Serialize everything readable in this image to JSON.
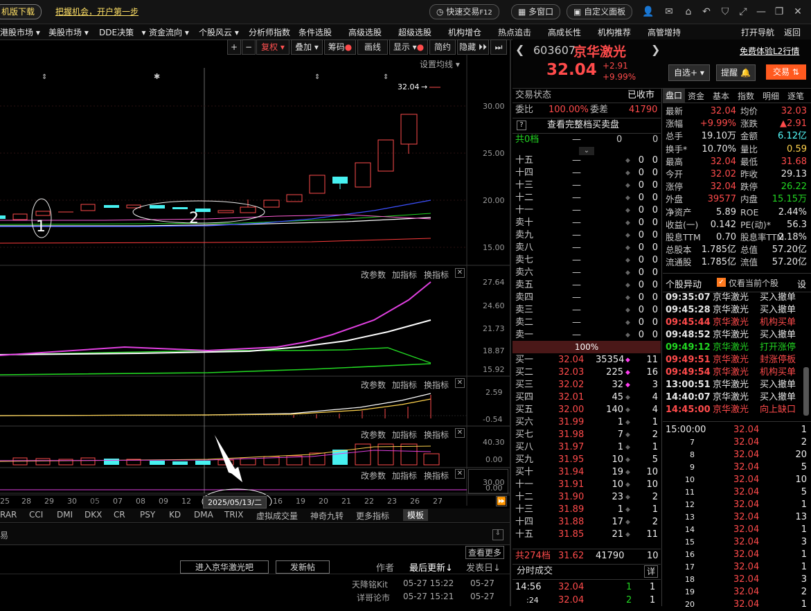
{
  "topbar": {
    "download": "机版下载",
    "promo": "把握机会，开户第一步",
    "quick_trade": "快速交易",
    "quick_trade_key": "F12",
    "multi_window": "多窗口",
    "custom_panel": "自定义面板"
  },
  "menu": [
    "港股市场",
    "美股市场",
    "DDE决策",
    "资金流向",
    "个股风云",
    "分析师指数",
    "条件选股",
    "高级选股",
    "超级选股",
    "机构增仓",
    "热点追击",
    "高成长性",
    "机构推荐",
    "高管增持"
  ],
  "menu_right": [
    "打开导航",
    "返回"
  ],
  "chart_toolbar": {
    "fuquan": "复权",
    "diejia": "叠加",
    "chouma": "筹码",
    "huaxian": "画线",
    "xianshi": "显示",
    "jianyue": "简约",
    "yincang": "隐藏",
    "set_ma": "设置均线"
  },
  "price_chart": {
    "last_label": "32.04",
    "y_ticks": [
      "30.00",
      "25.00",
      "20.00",
      "15.00"
    ],
    "annotations": [
      "1",
      "2"
    ]
  },
  "indicator_panels": [
    {
      "tools": [
        "改参数",
        "加指标",
        "换指标"
      ],
      "y_ticks": [
        "27.64",
        "24.60",
        "21.73",
        "18.87",
        "15.92"
      ]
    },
    {
      "tools": [
        "改参数",
        "加指标",
        "换指标"
      ],
      "y_ticks": [
        "2.59",
        "-0.54"
      ]
    },
    {
      "tools": [
        "改参数",
        "加指标",
        "换指标"
      ],
      "y_ticks": [
        "40.30",
        "0.00"
      ]
    },
    {
      "tools": [
        "改参数",
        "加指标",
        "换指标"
      ],
      "y_ticks": [
        "30.00",
        "0.00"
      ]
    }
  ],
  "x_dates": [
    "25",
    "28",
    "29",
    "30",
    "05",
    "07",
    "08",
    "09",
    "12",
    "2025/05/13/二",
    "16",
    "19",
    "20",
    "21",
    "22",
    "23",
    "26",
    "27"
  ],
  "indicator_tabs": [
    "RAR",
    "CCI",
    "DMI",
    "DKX",
    "CR",
    "PSY",
    "KD",
    "DMA",
    "TRIX",
    "虚拟成交量",
    "神奇九转",
    "更多指标",
    "模板"
  ],
  "forum": {
    "view_more": "查看更多",
    "enter": "进入京华激光吧",
    "post": "发新帖",
    "col_author": "作者",
    "col_updated": "最后更新↓",
    "col_posted": "发表日↓",
    "rows": [
      {
        "author": "天降铭Kit",
        "updated": "05-27 15:22",
        "posted": "05-27"
      },
      {
        "author": "详哥论市",
        "updated": "05-27 15:21",
        "posted": "05-27"
      }
    ]
  },
  "stock": {
    "code": "603607",
    "name": "京华激光",
    "price": "32.04",
    "change": "+2.91",
    "change_pct": "+9.99%",
    "l2_link": "免费体验L2行情",
    "btn_watch": "自选+",
    "btn_alert": "提醒",
    "btn_trade": "交易"
  },
  "order_book": {
    "status_label": "交易状态",
    "status_value": "已收市",
    "weibi_label": "委比",
    "weibi_value": "100.00%",
    "weicha_label": "委差",
    "weicha_value": "41790",
    "full_book": "查看完整档买卖盘",
    "sell_total": {
      "label": "共0档",
      "price": "—",
      "vol": "0",
      "cnt": "0"
    },
    "sells": [
      {
        "label": "十五",
        "price": "—",
        "vol": "0",
        "cnt": "0"
      },
      {
        "label": "十四",
        "price": "—",
        "vol": "0",
        "cnt": "0"
      },
      {
        "label": "十三",
        "price": "—",
        "vol": "0",
        "cnt": "0"
      },
      {
        "label": "十二",
        "price": "—",
        "vol": "0",
        "cnt": "0"
      },
      {
        "label": "十一",
        "price": "—",
        "vol": "0",
        "cnt": "0"
      },
      {
        "label": "卖十",
        "price": "—",
        "vol": "0",
        "cnt": "0"
      },
      {
        "label": "卖九",
        "price": "—",
        "vol": "0",
        "cnt": "0"
      },
      {
        "label": "卖八",
        "price": "—",
        "vol": "0",
        "cnt": "0"
      },
      {
        "label": "卖七",
        "price": "—",
        "vol": "0",
        "cnt": "0"
      },
      {
        "label": "卖六",
        "price": "—",
        "vol": "0",
        "cnt": "0"
      },
      {
        "label": "卖五",
        "price": "—",
        "vol": "0",
        "cnt": "0"
      },
      {
        "label": "卖四",
        "price": "—",
        "vol": "0",
        "cnt": "0"
      },
      {
        "label": "卖三",
        "price": "—",
        "vol": "0",
        "cnt": "0"
      },
      {
        "label": "卖二",
        "price": "—",
        "vol": "0",
        "cnt": "0"
      },
      {
        "label": "卖一",
        "price": "—",
        "vol": "0",
        "cnt": "0"
      }
    ],
    "ratio_bar": "100%",
    "buys": [
      {
        "label": "买一",
        "price": "32.04",
        "vol": "35354",
        "cnt": "11"
      },
      {
        "label": "买二",
        "price": "32.03",
        "vol": "225",
        "cnt": "16"
      },
      {
        "label": "买三",
        "price": "32.02",
        "vol": "32",
        "cnt": "3"
      },
      {
        "label": "买四",
        "price": "32.01",
        "vol": "45",
        "cnt": "4"
      },
      {
        "label": "买五",
        "price": "32.00",
        "vol": "140",
        "cnt": "4"
      },
      {
        "label": "买六",
        "price": "31.99",
        "vol": "1",
        "cnt": "1"
      },
      {
        "label": "买七",
        "price": "31.98",
        "vol": "7",
        "cnt": "2"
      },
      {
        "label": "买八",
        "price": "31.97",
        "vol": "1",
        "cnt": "1"
      },
      {
        "label": "买九",
        "price": "31.95",
        "vol": "10",
        "cnt": "5"
      },
      {
        "label": "买十",
        "price": "31.94",
        "vol": "19",
        "cnt": "10"
      },
      {
        "label": "十一",
        "price": "31.91",
        "vol": "10",
        "cnt": "10"
      },
      {
        "label": "十二",
        "price": "31.90",
        "vol": "23",
        "cnt": "2"
      },
      {
        "label": "十三",
        "price": "31.89",
        "vol": "1",
        "cnt": "1"
      },
      {
        "label": "十四",
        "price": "31.88",
        "vol": "17",
        "cnt": "2"
      },
      {
        "label": "十五",
        "price": "31.85",
        "vol": "21",
        "cnt": "11"
      }
    ],
    "buy_total": {
      "label": "共274档",
      "price": "31.62",
      "vol": "41790",
      "cnt": "10"
    }
  },
  "ticks_panel": {
    "title": "分时成交",
    "btn": "详",
    "rows": [
      {
        "time": "14:56",
        "price": "32.04",
        "vol": "1",
        "cnt": "1"
      },
      {
        "time": ":24",
        "price": "32.04",
        "vol": "2",
        "cnt": "1"
      }
    ]
  },
  "quote_tabs": [
    "盘口",
    "资金",
    "基本",
    "指数",
    "明细",
    "逐笔"
  ],
  "quote": [
    {
      "l": "最新",
      "v": "32.04",
      "vc": "red",
      "l2": "均价",
      "v2": "32.03",
      "v2c": "red"
    },
    {
      "l": "涨幅",
      "v": "+9.99%",
      "vc": "red",
      "l2": "涨跌",
      "v2": "▲2.91",
      "v2c": "red"
    },
    {
      "l": "总手",
      "v": "19.10万",
      "vc": "white",
      "l2": "金额",
      "v2": "6.12亿",
      "v2c": "cyan"
    },
    {
      "l": "换手*",
      "v": "10.70%",
      "vc": "white",
      "l2": "量比",
      "v2": "0.59",
      "v2c": "yellow"
    },
    {
      "l": "最高",
      "v": "32.04",
      "vc": "red",
      "l2": "最低",
      "v2": "31.68",
      "v2c": "red"
    },
    {
      "l": "今开",
      "v": "32.02",
      "vc": "red",
      "l2": "昨收",
      "v2": "29.13",
      "v2c": "white"
    },
    {
      "l": "涨停",
      "v": "32.04",
      "vc": "red",
      "l2": "跌停",
      "v2": "26.22",
      "v2c": "green"
    },
    {
      "l": "外盘",
      "v": "39577",
      "vc": "red",
      "l2": "内盘",
      "v2": "15.15万",
      "v2c": "green"
    },
    {
      "l": "净资产",
      "v": "5.89",
      "vc": "white",
      "l2": "ROE",
      "v2": "2.44%",
      "v2c": "white"
    },
    {
      "l": "收益(一)",
      "v": "0.142",
      "vc": "white",
      "l2": "PE(动)*",
      "v2": "56.3",
      "v2c": "white"
    },
    {
      "l": "股息TTM",
      "v": "0.70",
      "vc": "white",
      "l2": "股息率TTM",
      "v2": "2.18%",
      "v2c": "white"
    },
    {
      "l": "总股本",
      "v": "1.785亿",
      "vc": "white",
      "l2": "总值",
      "v2": "57.20亿",
      "v2c": "white"
    },
    {
      "l": "流通股",
      "v": "1.785亿",
      "vc": "white",
      "l2": "流值",
      "v2": "57.20亿",
      "v2c": "white"
    }
  ],
  "anomaly": {
    "title": "个股异动",
    "only_current": "仅看当前个股",
    "settings": "设",
    "rows": [
      {
        "time": "09:35:07",
        "name": "京华激光",
        "event": "买入撤单",
        "color": "white"
      },
      {
        "time": "09:45:28",
        "name": "京华激光",
        "event": "买入撤单",
        "color": "white"
      },
      {
        "time": "09:45:44",
        "name": "京华激光",
        "event": "机构买单",
        "color": "red"
      },
      {
        "time": "09:48:52",
        "name": "京华激光",
        "event": "买入撤单",
        "color": "white"
      },
      {
        "time": "09:49:12",
        "name": "京华激光",
        "event": "打开涨停",
        "color": "green"
      },
      {
        "time": "09:49:51",
        "name": "京华激光",
        "event": "封涨停板",
        "color": "red"
      },
      {
        "time": "09:49:54",
        "name": "京华激光",
        "event": "机构买单",
        "color": "red"
      },
      {
        "time": "13:00:51",
        "name": "京华激光",
        "event": "买入撤单",
        "color": "white"
      },
      {
        "time": "14:40:07",
        "name": "京华激光",
        "event": "买入撤单",
        "color": "white"
      },
      {
        "time": "14:45:00",
        "name": "京华激光",
        "event": "向上缺口",
        "color": "red"
      }
    ]
  },
  "minute_ticks": [
    {
      "t": "15:00:00",
      "p": "32.04",
      "v": "1"
    },
    {
      "t": "7",
      "p": "32.04",
      "v": "2"
    },
    {
      "t": "8",
      "p": "32.04",
      "v": "20"
    },
    {
      "t": "9",
      "p": "32.04",
      "v": "5"
    },
    {
      "t": "10",
      "p": "32.04",
      "v": "10"
    },
    {
      "t": "11",
      "p": "32.04",
      "v": "5"
    },
    {
      "t": "12",
      "p": "32.04",
      "v": "1"
    },
    {
      "t": "13",
      "p": "32.04",
      "v": "13"
    },
    {
      "t": "14",
      "p": "32.04",
      "v": "1"
    },
    {
      "t": "15",
      "p": "32.04",
      "v": "3"
    },
    {
      "t": "16",
      "p": "32.04",
      "v": "1"
    },
    {
      "t": "17",
      "p": "32.04",
      "v": "1"
    },
    {
      "t": "18",
      "p": "32.04",
      "v": "3"
    },
    {
      "t": "19",
      "p": "32.04",
      "v": "2"
    },
    {
      "t": "20",
      "p": "32.04",
      "v": "1"
    }
  ]
}
